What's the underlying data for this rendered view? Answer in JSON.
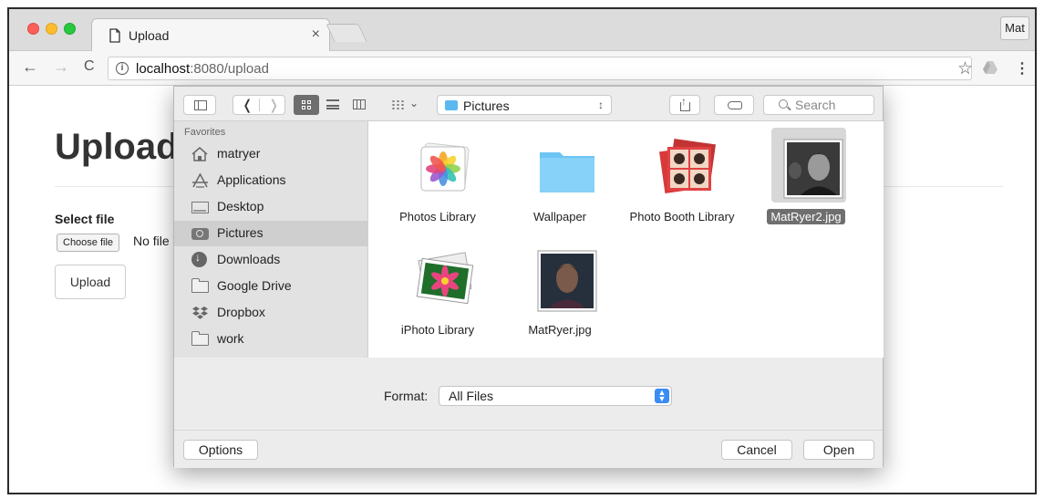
{
  "browser": {
    "tab": {
      "title": "Upload",
      "close": "×"
    },
    "profile": "Mat",
    "nav": {
      "back": "←",
      "forward": "→",
      "reload": "C"
    },
    "url": {
      "host": "localhost",
      "rest": ":8080/upload"
    },
    "icons": {
      "star": "☆",
      "menu": "⋮",
      "info": "i"
    }
  },
  "page": {
    "heading": "Upload",
    "select_label": "Select file",
    "choose_file": "Choose file",
    "no_file": "No file chosen",
    "upload_button": "Upload"
  },
  "dialog": {
    "location": "Pictures",
    "search_placeholder": "Search",
    "sidebar": {
      "header": "Favorites",
      "items": [
        {
          "label": "matryer",
          "icon": "home-icon"
        },
        {
          "label": "Applications",
          "icon": "applications-icon"
        },
        {
          "label": "Desktop",
          "icon": "desktop-icon"
        },
        {
          "label": "Pictures",
          "icon": "camera-icon",
          "selected": true
        },
        {
          "label": "Downloads",
          "icon": "download-icon"
        },
        {
          "label": "Google Drive",
          "icon": "folder-icon"
        },
        {
          "label": "Dropbox",
          "icon": "dropbox-icon"
        },
        {
          "label": "work",
          "icon": "folder-icon"
        }
      ]
    },
    "files": [
      {
        "label": "Photos Library"
      },
      {
        "label": "Wallpaper"
      },
      {
        "label": "Photo Booth Library"
      },
      {
        "label": "MatRyer2.jpg",
        "selected": true
      },
      {
        "label": "iPhoto Library"
      },
      {
        "label": "MatRyer.jpg"
      }
    ],
    "format_label": "Format:",
    "format_value": "All Files",
    "options_button": "Options",
    "cancel_button": "Cancel",
    "open_button": "Open"
  },
  "colors": {
    "accent": "#3b8cf5",
    "folder": "#5bb9ef",
    "close": "#fc5f57",
    "minimize": "#fdbc2e",
    "maximize": "#28c840"
  }
}
